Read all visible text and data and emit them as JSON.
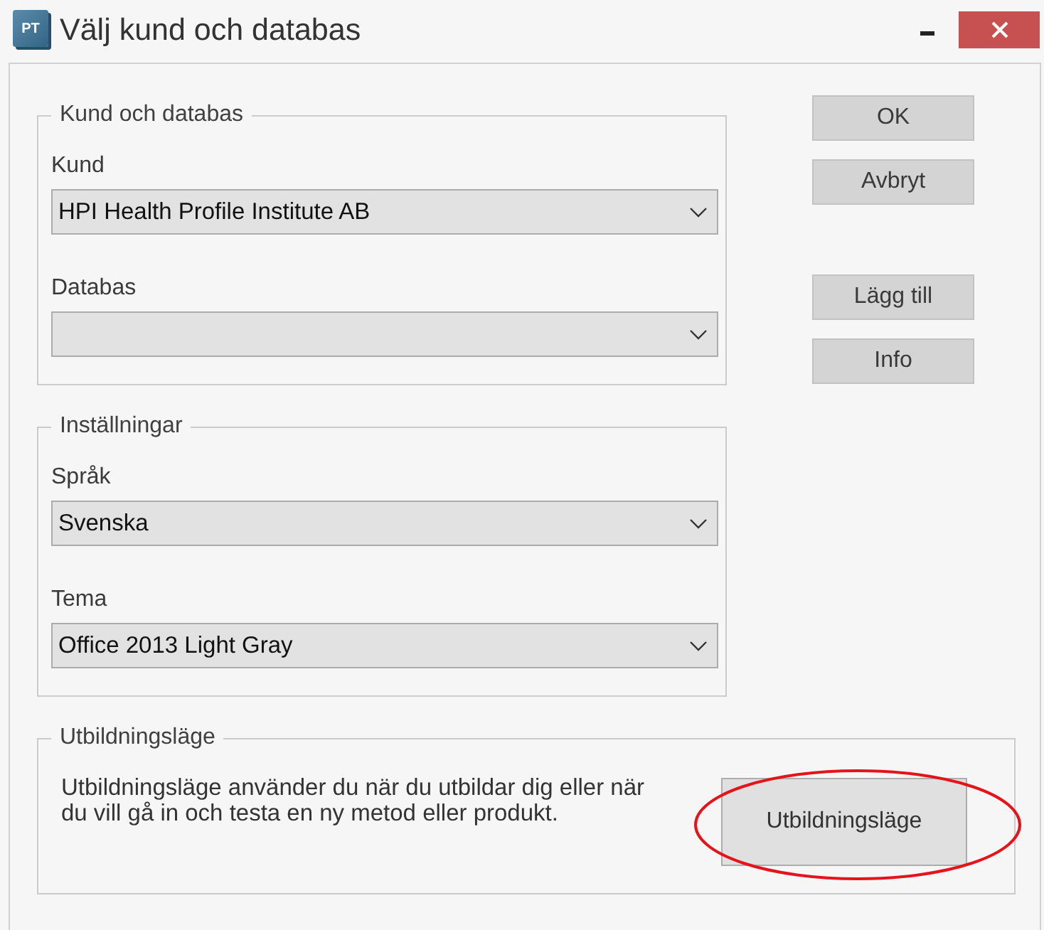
{
  "window": {
    "icon_text": "PT",
    "title": "Välj kund och databas"
  },
  "groups": [
    {
      "legend": "Kund och databas",
      "fields": [
        {
          "label": "Kund",
          "value": "HPI Health Profile Institute AB"
        },
        {
          "label": "Databas"
        }
      ]
    },
    {
      "legend": "Inställningar",
      "fields": [
        {
          "label": "Språk",
          "value": "Svenska"
        },
        {
          "label": "Tema",
          "value": "Office 2013 Light Gray"
        }
      ]
    }
  ],
  "button_groups": [
    [
      {
        "label": "OK"
      },
      {
        "label": "Avbryt"
      }
    ],
    [
      {
        "label": "Lägg till"
      },
      {
        "label": "Info"
      }
    ]
  ],
  "training": {
    "legend": "Utbildningsläge",
    "description": "Utbildningsläge använder du när du utbildar dig eller när du vill gå in och testa en ny metod eller produkt.",
    "button": {
      "label": "Utbildningsläge",
      "highlighted": true
    }
  }
}
